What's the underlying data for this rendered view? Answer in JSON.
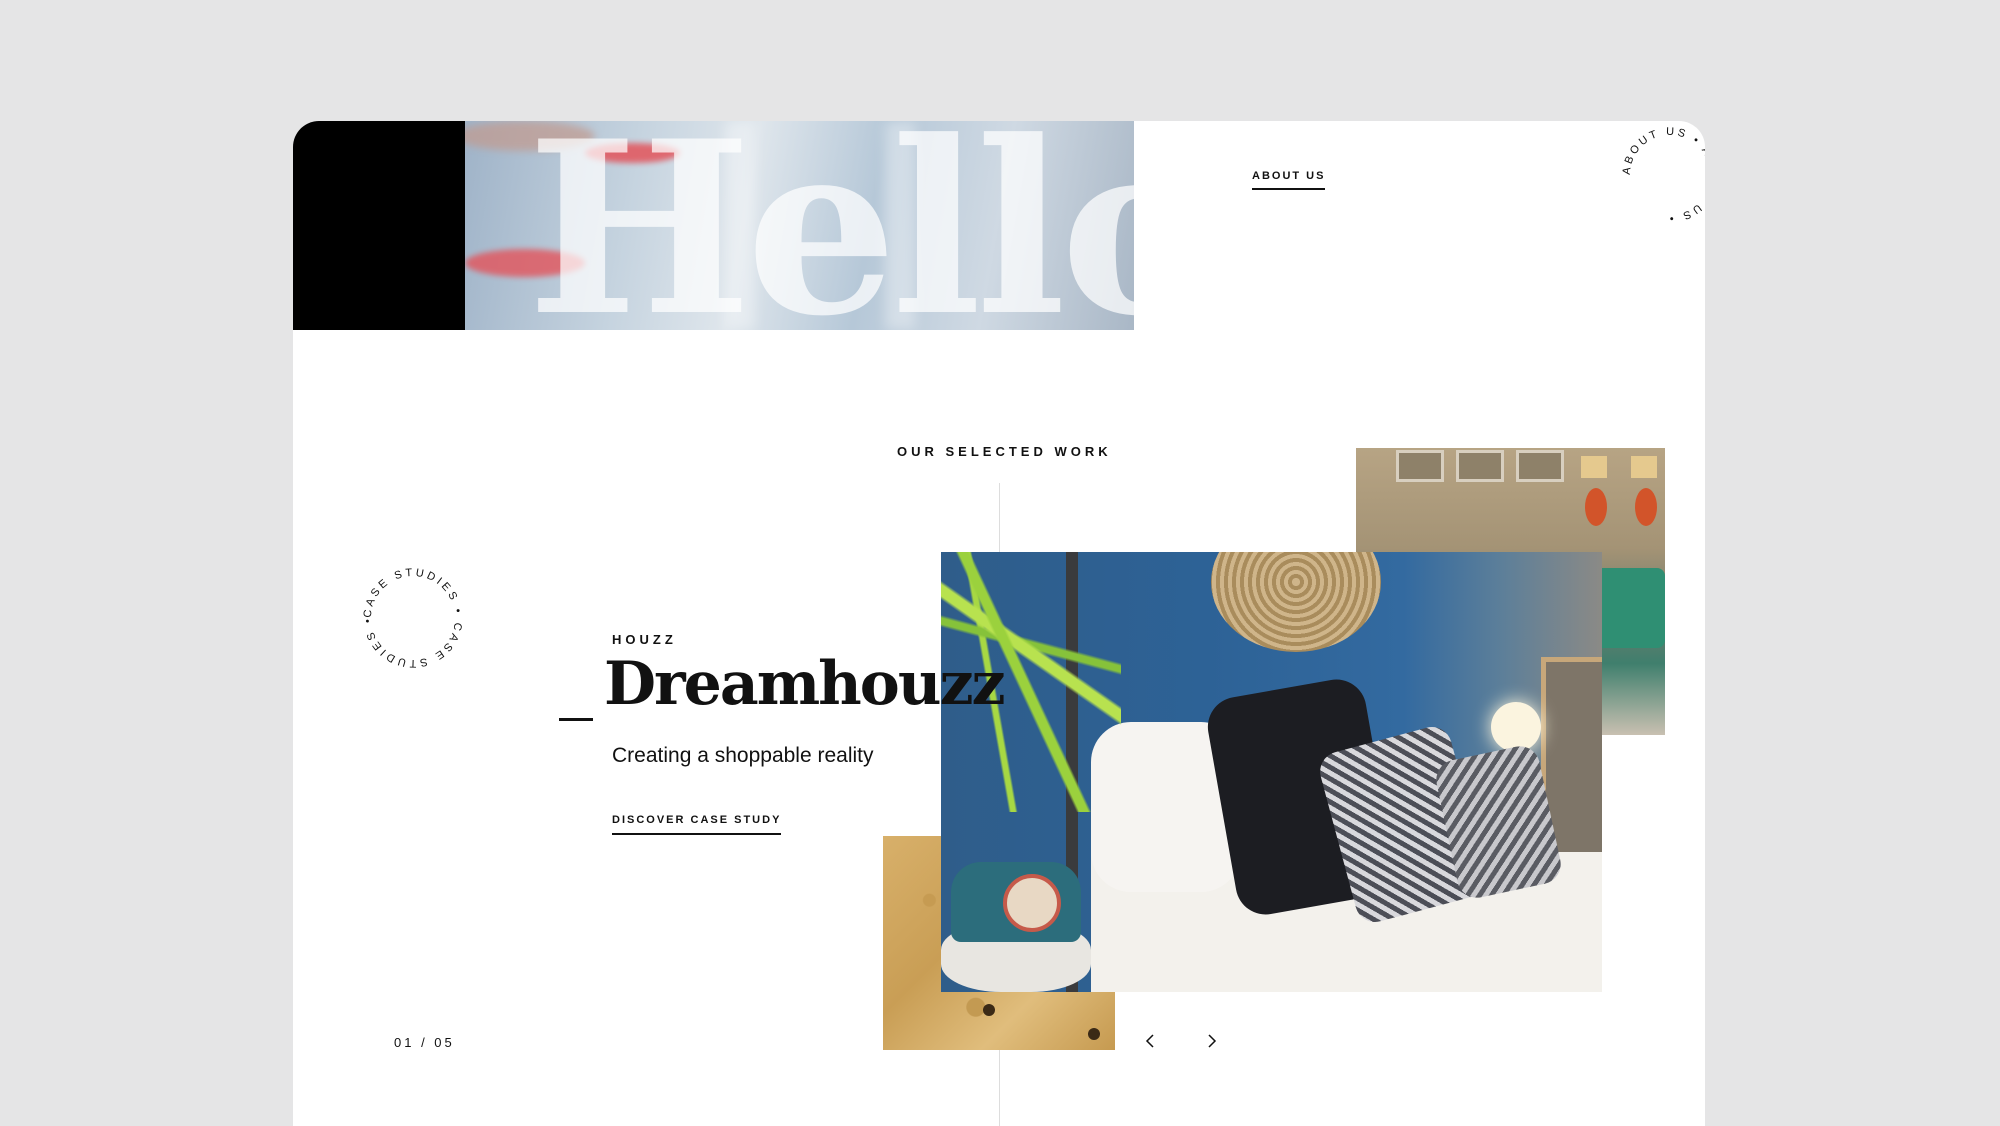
{
  "header": {
    "hero_word": "Hello",
    "about_link": "ABOUT US",
    "about_badge_text": "ABOUT US • ABOUT US • "
  },
  "work": {
    "section_title": "OUR SELECTED WORK",
    "badge_text": "CASE STUDIES • CASE STUDIES • ",
    "client": "HOUZZ",
    "title": "Dreamhouzz",
    "subtitle": "Creating a shoppable reality",
    "cta": "DISCOVER CASE STUDY",
    "pager": "01 / 05",
    "prev_icon": "chevron-left-icon",
    "next_icon": "chevron-right-icon"
  },
  "colors": {
    "page_bg": "#e5e5e6",
    "card_bg": "#ffffff",
    "text": "#111111",
    "accent_black": "#000000"
  }
}
